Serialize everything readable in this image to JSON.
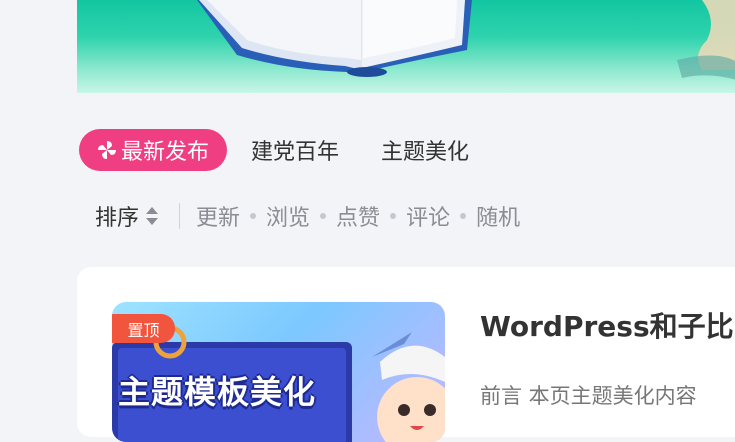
{
  "tabs": [
    {
      "label": "最新发布",
      "active": true
    },
    {
      "label": "建党百年",
      "active": false
    },
    {
      "label": "主题美化",
      "active": false
    }
  ],
  "sort": {
    "label": "排序",
    "options": [
      "更新",
      "浏览",
      "点赞",
      "评论",
      "随机"
    ]
  },
  "post": {
    "badge": "置顶",
    "thumbnail_text": "主题模板美化",
    "title": "WordPress和子比",
    "excerpt": "前言 本页主题美化内容"
  },
  "colors": {
    "accent": "#ef3e82",
    "badge": "#f2553d",
    "banner": "#12c6a1"
  }
}
